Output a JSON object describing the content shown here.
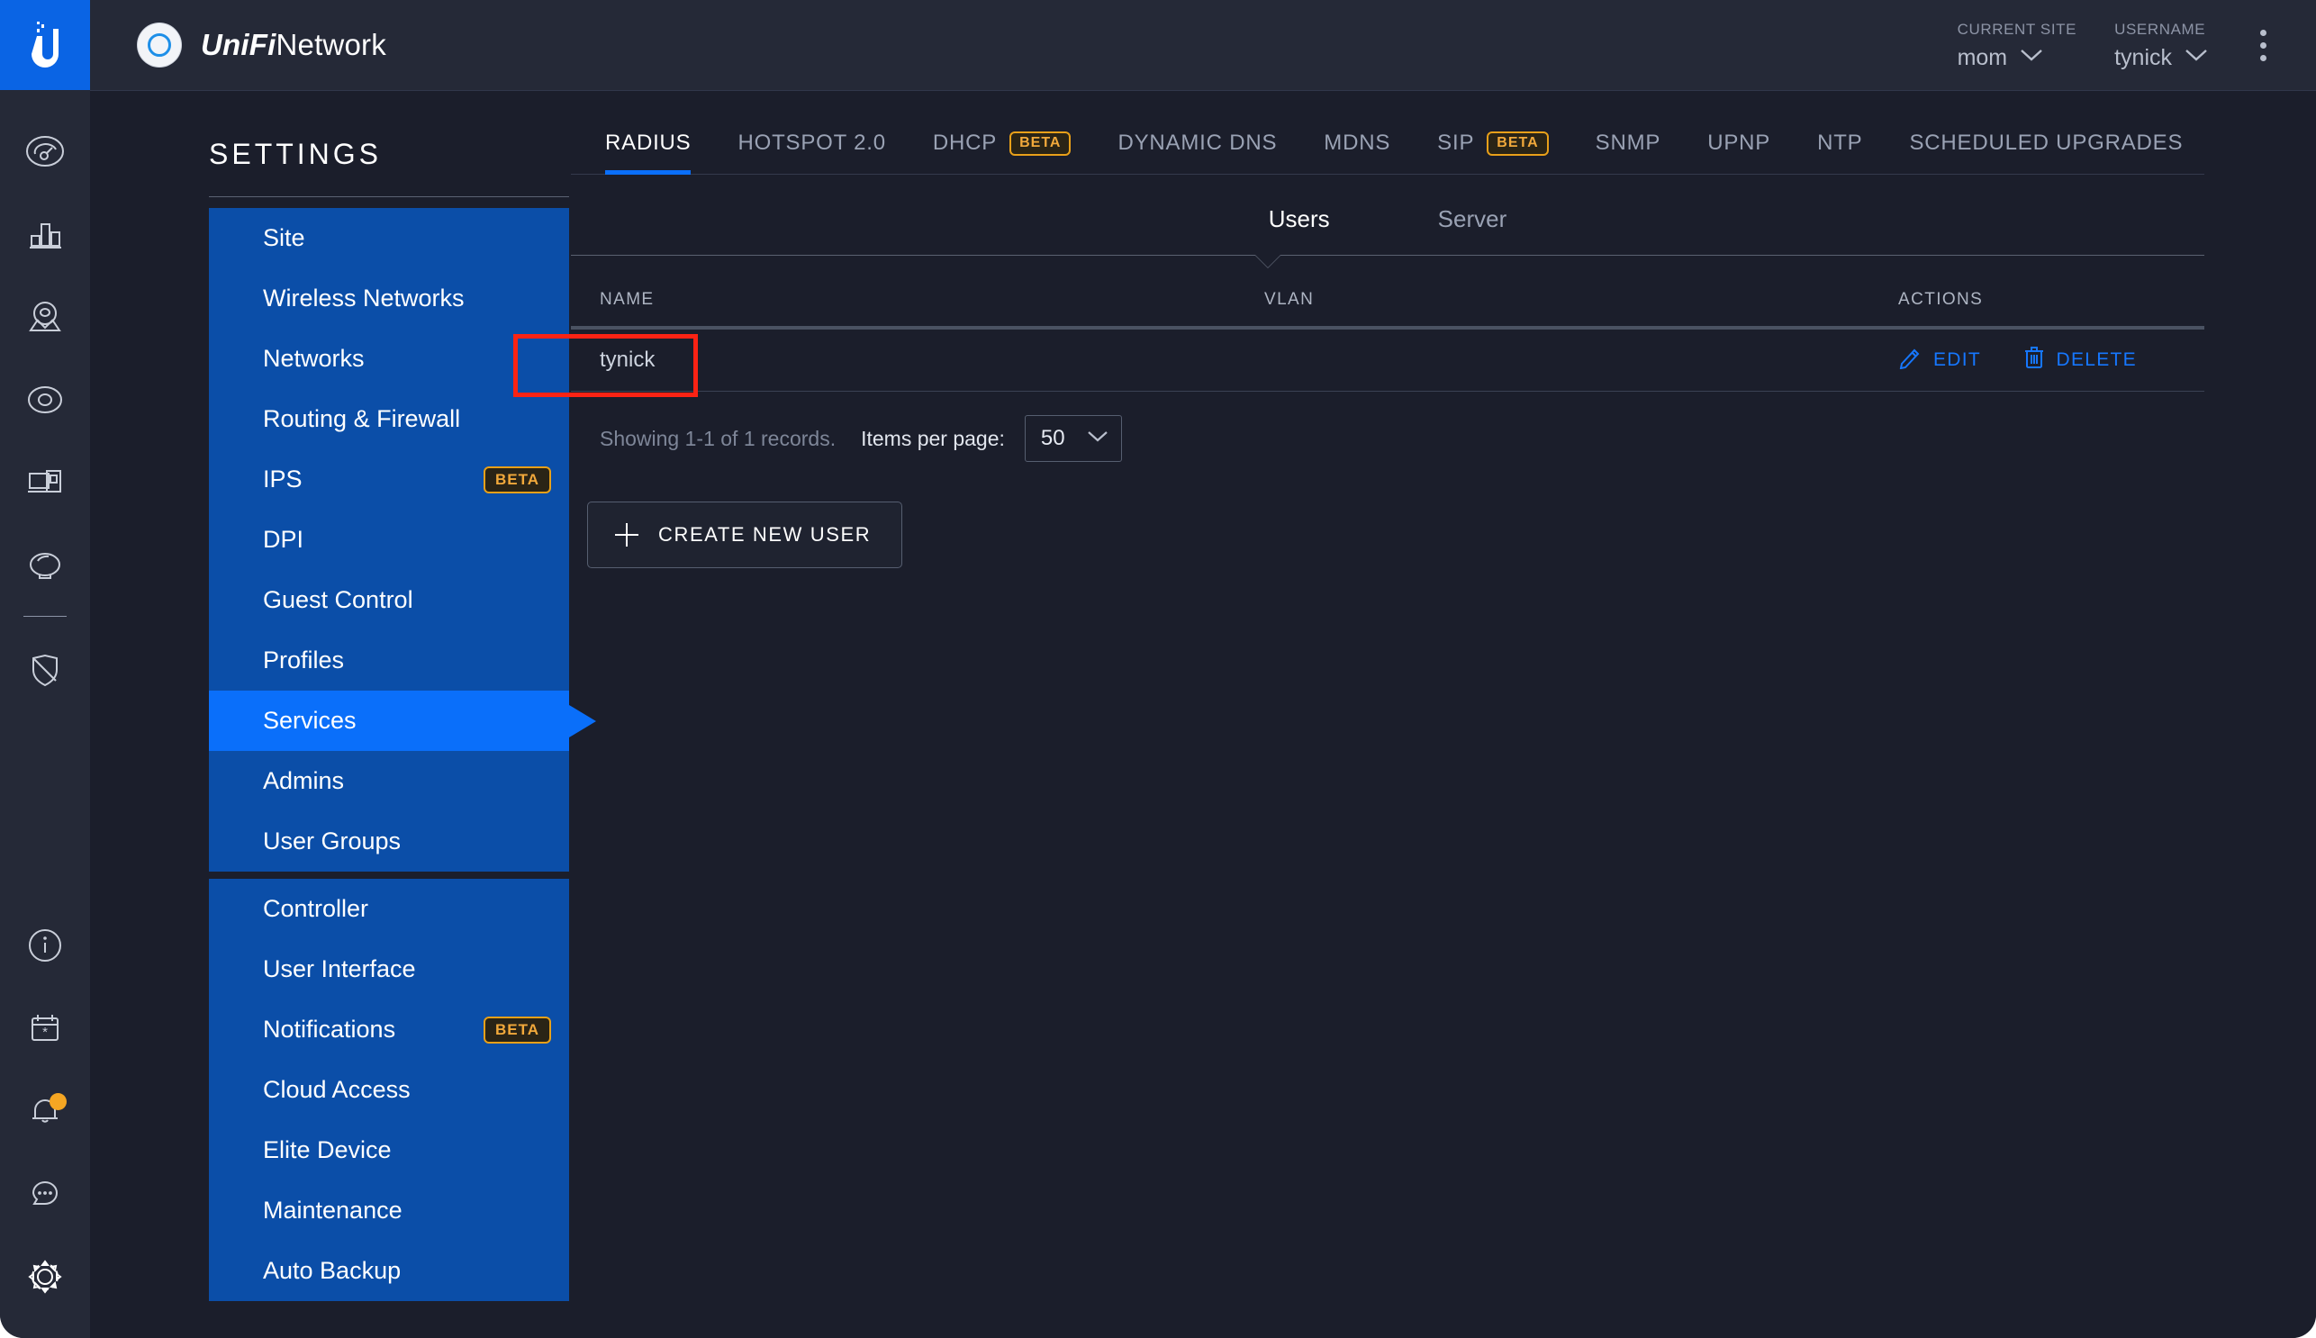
{
  "app": {
    "brand_primary": "UniFi",
    "brand_secondary": "Network",
    "accent_blue": "#0a6ffa",
    "beta_color": "#f2a93b",
    "annotation_color": "#fb2314"
  },
  "header": {
    "site": {
      "label": "CURRENT SITE",
      "value": "mom"
    },
    "user": {
      "label": "USERNAME",
      "value": "tynick"
    }
  },
  "rail": {
    "top_icons": [
      {
        "name": "dashboard-icon"
      },
      {
        "name": "statistics-icon"
      },
      {
        "name": "map-icon"
      },
      {
        "name": "devices-icon"
      },
      {
        "name": "clients-icon"
      },
      {
        "name": "insights-icon"
      }
    ],
    "threat_icon": {
      "name": "threat-management-icon"
    },
    "bottom_icons": [
      {
        "name": "info-icon"
      },
      {
        "name": "events-icon"
      },
      {
        "name": "alerts-icon",
        "badge": true
      },
      {
        "name": "chat-icon"
      },
      {
        "name": "settings-gear-icon"
      }
    ]
  },
  "settings": {
    "title": "SETTINGS",
    "group1": [
      {
        "label": "Site",
        "beta": ""
      },
      {
        "label": "Wireless Networks",
        "beta": ""
      },
      {
        "label": "Networks",
        "beta": ""
      },
      {
        "label": "Routing & Firewall",
        "beta": ""
      },
      {
        "label": "IPS",
        "beta": "BETA"
      },
      {
        "label": "DPI",
        "beta": ""
      },
      {
        "label": "Guest Control",
        "beta": ""
      },
      {
        "label": "Profiles",
        "beta": ""
      },
      {
        "label": "Services",
        "beta": "",
        "active": true
      },
      {
        "label": "Admins",
        "beta": ""
      },
      {
        "label": "User Groups",
        "beta": ""
      }
    ],
    "group2": [
      {
        "label": "Controller",
        "beta": ""
      },
      {
        "label": "User Interface",
        "beta": ""
      },
      {
        "label": "Notifications",
        "beta": "BETA"
      },
      {
        "label": "Cloud Access",
        "beta": ""
      },
      {
        "label": "Elite Device",
        "beta": ""
      },
      {
        "label": "Maintenance",
        "beta": ""
      },
      {
        "label": "Auto Backup",
        "beta": ""
      }
    ]
  },
  "main": {
    "tabs": [
      {
        "label": "RADIUS",
        "beta": "",
        "active": true
      },
      {
        "label": "HOTSPOT 2.0",
        "beta": ""
      },
      {
        "label": "DHCP",
        "beta": "BETA"
      },
      {
        "label": "DYNAMIC DNS",
        "beta": ""
      },
      {
        "label": "MDNS",
        "beta": ""
      },
      {
        "label": "SIP",
        "beta": "BETA"
      },
      {
        "label": "SNMP",
        "beta": ""
      },
      {
        "label": "UPNP",
        "beta": ""
      },
      {
        "label": "NTP",
        "beta": ""
      },
      {
        "label": "SCHEDULED UPGRADES",
        "beta": ""
      }
    ],
    "subtabs": [
      {
        "label": "Users",
        "active": true
      },
      {
        "label": "Server",
        "active": false
      }
    ],
    "table": {
      "columns": [
        "NAME",
        "VLAN",
        "ACTIONS"
      ],
      "rows": [
        {
          "name": "tynick",
          "vlan": "",
          "edit": "EDIT",
          "delete": "DELETE"
        }
      ]
    },
    "pager": {
      "info": "Showing 1-1 of 1 records.",
      "items_label": "Items per page:",
      "items_value": "50"
    },
    "create_button": "CREATE NEW USER"
  }
}
